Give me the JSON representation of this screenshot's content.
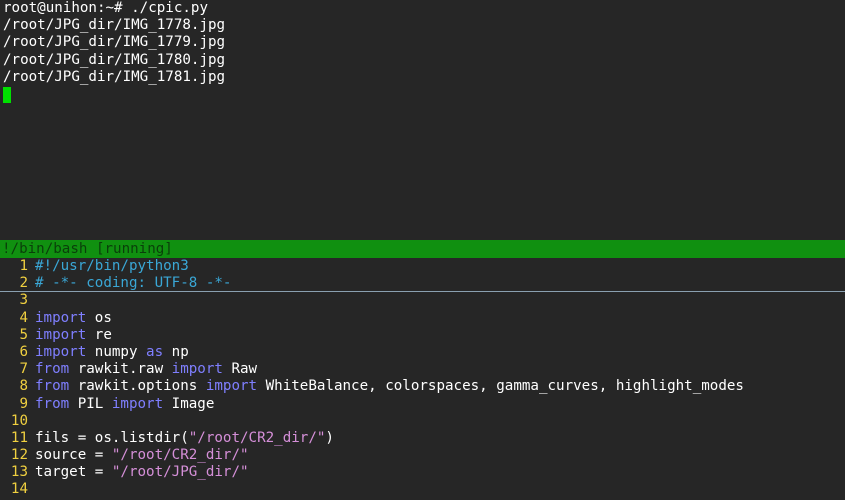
{
  "colors": {
    "background": "#262626",
    "status_bar_bg": "#109010",
    "status_bar_fg": "#0a3f0a",
    "cursor": "#00e000",
    "line_number": "#f0d040",
    "keyword": "#7f7fff",
    "comment": "#3aa7d6",
    "string": "#d58fd8"
  },
  "terminal": {
    "lines": [
      "root@unihon:~# ./cpic.py",
      "/root/JPG_dir/IMG_1778.jpg",
      "/root/JPG_dir/IMG_1779.jpg",
      "/root/JPG_dir/IMG_1780.jpg",
      "/root/JPG_dir/IMG_1781.jpg"
    ]
  },
  "status_bar": {
    "text": "!/bin/bash [running]"
  },
  "editor": {
    "lines": [
      {
        "num": "1",
        "tokens": [
          {
            "t": "cmt",
            "v": "#!/usr/bin/python3"
          }
        ]
      },
      {
        "num": "2",
        "tokens": [
          {
            "t": "cmt",
            "v": "# -*- coding: UTF-8 -*-"
          }
        ]
      },
      {
        "num": "3",
        "tokens": []
      },
      {
        "num": "4",
        "tokens": [
          {
            "t": "kw",
            "v": "import"
          },
          {
            "t": "plain",
            "v": " os"
          }
        ]
      },
      {
        "num": "5",
        "tokens": [
          {
            "t": "kw",
            "v": "import"
          },
          {
            "t": "plain",
            "v": " re"
          }
        ]
      },
      {
        "num": "6",
        "tokens": [
          {
            "t": "kw",
            "v": "import"
          },
          {
            "t": "plain",
            "v": " numpy "
          },
          {
            "t": "kw",
            "v": "as"
          },
          {
            "t": "plain",
            "v": " np"
          }
        ]
      },
      {
        "num": "7",
        "tokens": [
          {
            "t": "kw",
            "v": "from"
          },
          {
            "t": "plain",
            "v": " rawkit.raw "
          },
          {
            "t": "kw",
            "v": "import"
          },
          {
            "t": "plain",
            "v": " Raw"
          }
        ]
      },
      {
        "num": "8",
        "tokens": [
          {
            "t": "kw",
            "v": "from"
          },
          {
            "t": "plain",
            "v": " rawkit.options "
          },
          {
            "t": "kw",
            "v": "import"
          },
          {
            "t": "plain",
            "v": " WhiteBalance, colorspaces, gamma_curves, highlight_modes"
          }
        ]
      },
      {
        "num": "9",
        "tokens": [
          {
            "t": "kw",
            "v": "from"
          },
          {
            "t": "plain",
            "v": " PIL "
          },
          {
            "t": "kw",
            "v": "import"
          },
          {
            "t": "plain",
            "v": " Image"
          }
        ]
      },
      {
        "num": "10",
        "tokens": []
      },
      {
        "num": "11",
        "tokens": [
          {
            "t": "plain",
            "v": "fils = os.listdir("
          },
          {
            "t": "str",
            "v": "\"/root/CR2_dir/\""
          },
          {
            "t": "plain",
            "v": ")"
          }
        ]
      },
      {
        "num": "12",
        "tokens": [
          {
            "t": "plain",
            "v": "source = "
          },
          {
            "t": "str",
            "v": "\"/root/CR2_dir/\""
          }
        ]
      },
      {
        "num": "13",
        "tokens": [
          {
            "t": "plain",
            "v": "target = "
          },
          {
            "t": "str",
            "v": "\"/root/JPG_dir/\""
          }
        ]
      },
      {
        "num": "14",
        "tokens": []
      }
    ]
  }
}
